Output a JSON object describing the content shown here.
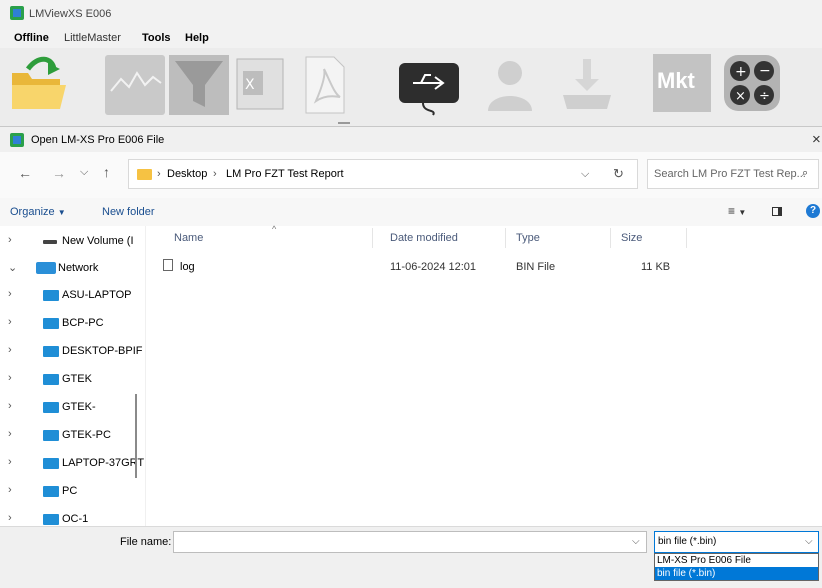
{
  "app": {
    "title": "LMViewXS E006",
    "menu": [
      "Offline",
      "LittleMaster",
      "Tools",
      "Help"
    ]
  },
  "dialog": {
    "title": "Open LM-XS Pro E006 File",
    "breadcrumb": [
      "Desktop",
      "LM Pro FZT Test Report"
    ],
    "search_placeholder": "Search LM Pro FZT Test Rep...",
    "organize_label": "Organize",
    "new_folder_label": "New folder",
    "nav": [
      {
        "label": "New Volume (I",
        "type": "drive"
      },
      {
        "label": "Network",
        "type": "network",
        "expanded": true
      },
      {
        "label": "ASU-LAPTOP",
        "type": "pc"
      },
      {
        "label": "BCP-PC",
        "type": "pc"
      },
      {
        "label": "DESKTOP-BPIF",
        "type": "pc"
      },
      {
        "label": "GTEK",
        "type": "pc"
      },
      {
        "label": "GTEK-",
        "type": "pc"
      },
      {
        "label": "GTEK-PC",
        "type": "pc"
      },
      {
        "label": "LAPTOP-37GRT",
        "type": "pc"
      },
      {
        "label": "PC",
        "type": "pc"
      },
      {
        "label": "OC-1",
        "type": "pc"
      }
    ],
    "columns": [
      "Name",
      "Date modified",
      "Type",
      "Size"
    ],
    "files": [
      {
        "name": "log",
        "date": "11-06-2024 12:01",
        "type": "BIN File",
        "size": "11 KB"
      }
    ],
    "filename_label": "File name:",
    "filename_value": "",
    "filetype_selected": "bin file (*.bin)",
    "filetype_options": [
      "LM-XS Pro E006 File",
      "bin file (*.bin)"
    ],
    "toolbar_mkt_label": "Mkt",
    "colors": {
      "accent": "#0078d7",
      "folder": "#f6c243",
      "pc": "#1f8ed6"
    }
  }
}
